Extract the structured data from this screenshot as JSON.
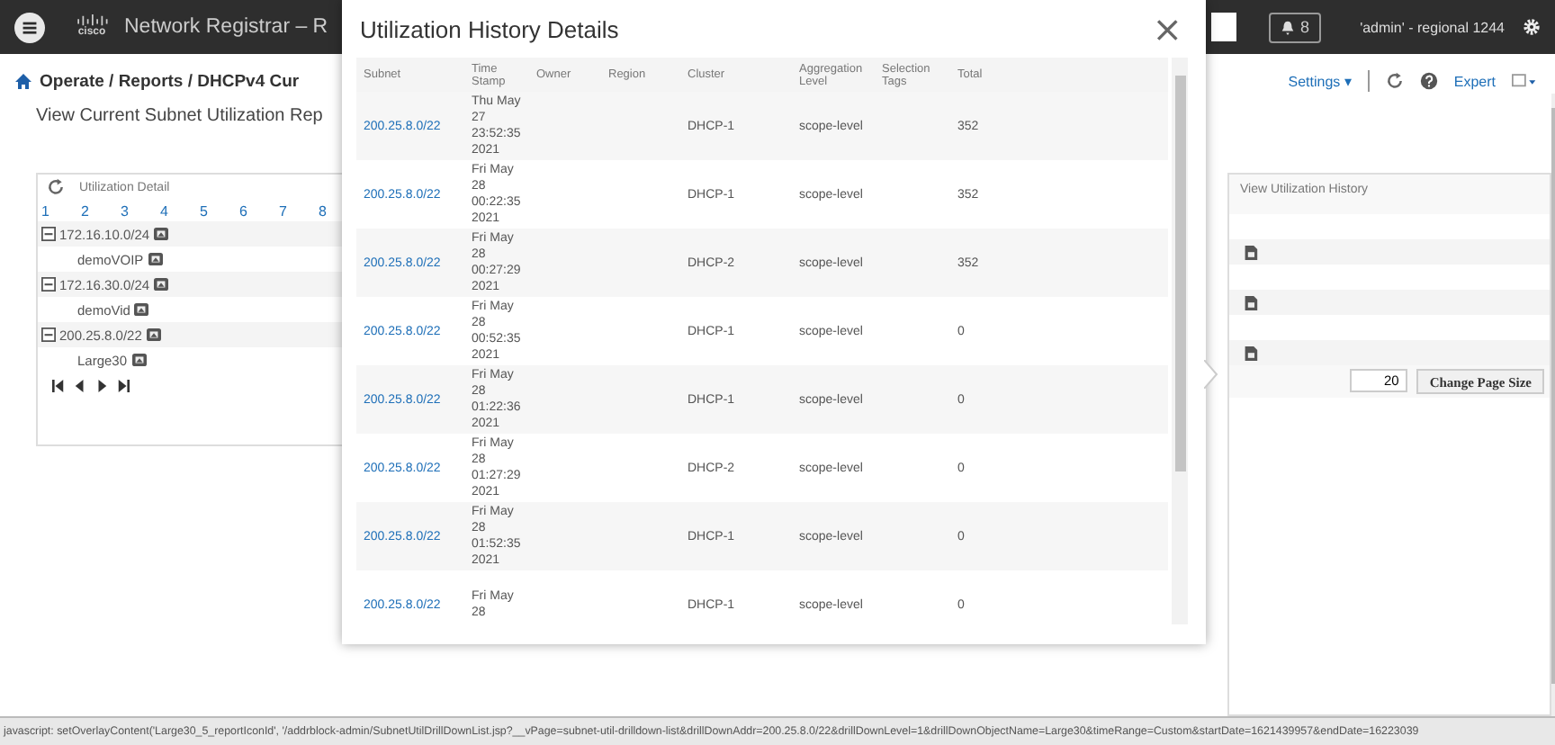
{
  "header": {
    "product": "Network Registrar – R",
    "logo_text": "cisco",
    "alerts": "8",
    "user": "'admin' - regional 1244"
  },
  "breadcrumb": "Operate / Reports / DHCPv4 Cur",
  "subtitle": "View Current Subnet Utilization Rep",
  "toolbar": {
    "settings": "Settings ▾",
    "mode": "Expert"
  },
  "detail_panel": {
    "title": "Utilization Detail",
    "pages": [
      "1",
      "2",
      "3",
      "4",
      "5",
      "6",
      "7",
      "8"
    ],
    "tree": [
      {
        "label": "172.16.10.0/24",
        "expanded": true,
        "children": [
          {
            "label": "demoVOIP"
          }
        ]
      },
      {
        "label": "172.16.30.0/24",
        "expanded": true,
        "children": [
          {
            "label": "demoVid"
          }
        ]
      },
      {
        "label": "200.25.8.0/22",
        "expanded": true,
        "children": [
          {
            "label": "Large30"
          }
        ]
      }
    ]
  },
  "history_panel": {
    "title": "View Utilization History",
    "page_size": "20",
    "button": "Change Page Size"
  },
  "modal": {
    "title": "Utilization History Details",
    "close": "×",
    "columns": [
      {
        "label": "Subnet"
      },
      {
        "label": "Time Stamp"
      },
      {
        "label": "Owner"
      },
      {
        "label": "Region"
      },
      {
        "label": "Cluster"
      },
      {
        "label": "Aggregation Level"
      },
      {
        "label": "Selection Tags"
      },
      {
        "label": "Total"
      }
    ],
    "rows": [
      {
        "subnet": "200.25.8.0/22",
        "timestamp": [
          "Thu May",
          "27",
          "23:52:35",
          "2021"
        ],
        "cluster": "DHCP-1",
        "aggregation": "scope-level",
        "total": "352"
      },
      {
        "subnet": "200.25.8.0/22",
        "timestamp": [
          "Fri May",
          "28",
          "00:22:35",
          "2021"
        ],
        "cluster": "DHCP-1",
        "aggregation": "scope-level",
        "total": "352"
      },
      {
        "subnet": "200.25.8.0/22",
        "timestamp": [
          "Fri May",
          "28",
          "00:27:29",
          "2021"
        ],
        "cluster": "DHCP-2",
        "aggregation": "scope-level",
        "total": "352"
      },
      {
        "subnet": "200.25.8.0/22",
        "timestamp": [
          "Fri May",
          "28",
          "00:52:35",
          "2021"
        ],
        "cluster": "DHCP-1",
        "aggregation": "scope-level",
        "total": "0"
      },
      {
        "subnet": "200.25.8.0/22",
        "timestamp": [
          "Fri May",
          "28",
          "01:22:36",
          "2021"
        ],
        "cluster": "DHCP-1",
        "aggregation": "scope-level",
        "total": "0"
      },
      {
        "subnet": "200.25.8.0/22",
        "timestamp": [
          "Fri May",
          "28",
          "01:27:29",
          "2021"
        ],
        "cluster": "DHCP-2",
        "aggregation": "scope-level",
        "total": "0"
      },
      {
        "subnet": "200.25.8.0/22",
        "timestamp": [
          "Fri May",
          "28",
          "01:52:35",
          "2021"
        ],
        "cluster": "DHCP-1",
        "aggregation": "scope-level",
        "total": "0"
      },
      {
        "subnet": "200.25.8.0/22",
        "timestamp": [
          "Fri May",
          "28"
        ],
        "cluster": "DHCP-1",
        "aggregation": "scope-level",
        "total": "0"
      }
    ]
  },
  "status_bar": "javascript: setOverlayContent('Large30_5_reportIconId', '/addrblock-admin/SubnetUtilDrillDownList.jsp?__vPage=subnet-util-drilldown-list&drillDownAddr=200.25.8.0/22&drillDownLevel=1&drillDownObjectName=Large30&timeRange=Custom&startDate=1621439957&endDate=16223039"
}
